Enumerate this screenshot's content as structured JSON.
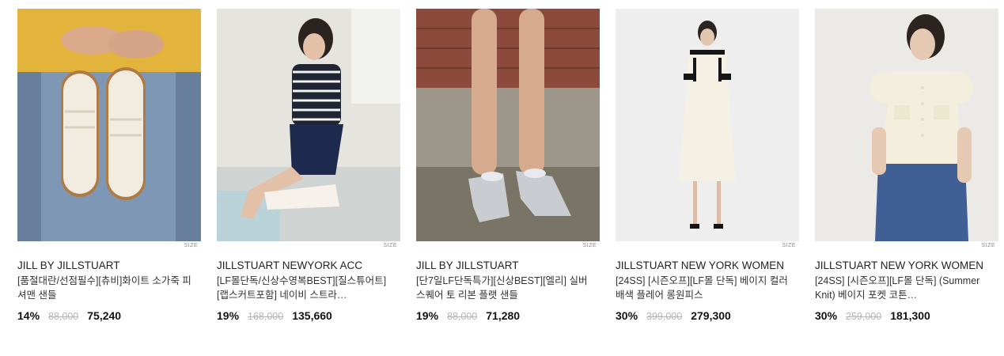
{
  "products": [
    {
      "brand": "JILL BY JILLSTUART",
      "name": "[품절대란/선점필수][츄비]화이트 소가죽 피셔맨 샌들",
      "discount": "14%",
      "original_price": "88,000",
      "sale_price": "75,240",
      "size_label": "SIZE"
    },
    {
      "brand": "JILLSTUART NEWYORK ACC",
      "name": "[LF몰단독/신상수영복BEST][질스튜어트][랩스커트포함] 네이비 스트라…",
      "discount": "19%",
      "original_price": "168,000",
      "sale_price": "135,660",
      "size_label": "SIZE"
    },
    {
      "brand": "JILL BY JILLSTUART",
      "name": "[단7일LF단독특가][신상BEST][엘리] 실버 스퀘어 토 리본 플랫 샌들",
      "discount": "19%",
      "original_price": "88,000",
      "sale_price": "71,280",
      "size_label": "SIZE"
    },
    {
      "brand": "JILLSTUART NEW YORK WOMEN",
      "name": "[24SS] [시즌오프][LF몰 단독] 베이지 컬러배색 플레어 롱원피스",
      "discount": "30%",
      "original_price": "399,000",
      "sale_price": "279,300",
      "size_label": "SIZE"
    },
    {
      "brand": "JILLSTUART NEW YORK WOMEN",
      "name": "[24SS] [시즌오프][LF몰 단독] (Summer Knit) 베이지 포켓 코튼…",
      "discount": "30%",
      "original_price": "259,000",
      "sale_price": "181,300",
      "size_label": "SIZE"
    }
  ]
}
